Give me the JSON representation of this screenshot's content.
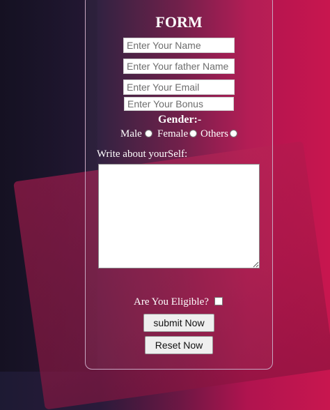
{
  "form": {
    "title": "FORM",
    "name_placeholder": "Enter Your Name",
    "father_placeholder": "Enter Your father Name",
    "email_placeholder": "Enter Your Email",
    "bonus_placeholder": "Enter Your Bonus",
    "gender_label": "Gender:-",
    "gender_options": [
      "Male",
      "Female",
      "Others"
    ],
    "about_label": "Write about yourSelf:",
    "eligible_label": "Are You Eligible?",
    "submit_label": "submit Now",
    "reset_label": "Reset Now"
  },
  "colors": {
    "accent": "#c8164f",
    "card_border": "#c9a7c2",
    "background_dark": "#1d1a33"
  }
}
